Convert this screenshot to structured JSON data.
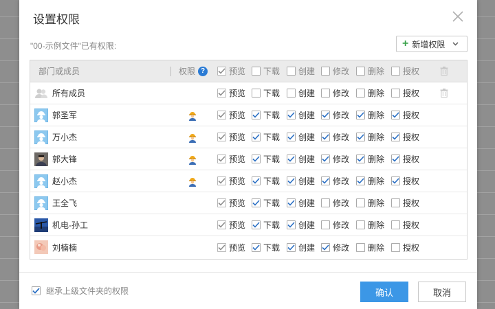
{
  "dialog": {
    "title": "设置权限",
    "subtitle": "\"00-示例文件\"已有权限:",
    "add_button_label": "新增权限"
  },
  "table": {
    "header": {
      "member_col": "部门或成员",
      "perm_col": "权限",
      "permissions": [
        "预览",
        "下载",
        "创建",
        "修改",
        "删除",
        "授权"
      ]
    },
    "rows": [
      {
        "name": "所有成员",
        "avatar": "group-avatar",
        "role_icon": false,
        "perms": [
          true,
          false,
          false,
          false,
          false,
          false
        ],
        "deletable": true
      },
      {
        "name": "郭圣军",
        "avatar": "worker-avatar",
        "role_icon": true,
        "perms": [
          true,
          true,
          true,
          true,
          true,
          true
        ],
        "deletable": false
      },
      {
        "name": "万小杰",
        "avatar": "worker-avatar",
        "role_icon": true,
        "perms": [
          true,
          true,
          true,
          true,
          true,
          true
        ],
        "deletable": false
      },
      {
        "name": "郭大锋",
        "avatar": "photo-avatar",
        "role_icon": true,
        "perms": [
          true,
          true,
          true,
          true,
          true,
          true
        ],
        "deletable": false
      },
      {
        "name": "赵小杰",
        "avatar": "worker-avatar",
        "role_icon": true,
        "perms": [
          true,
          true,
          true,
          true,
          true,
          true
        ],
        "deletable": false
      },
      {
        "name": "王全飞",
        "avatar": "worker-avatar",
        "role_icon": false,
        "perms": [
          true,
          true,
          true,
          false,
          false,
          false
        ],
        "deletable": false
      },
      {
        "name": "机电-孙工",
        "avatar": "photo-avatar-2",
        "role_icon": false,
        "perms": [
          true,
          true,
          true,
          false,
          false,
          false
        ],
        "deletable": false
      },
      {
        "name": "刘楠楠",
        "avatar": "photo-avatar-3",
        "role_icon": false,
        "perms": [
          true,
          true,
          true,
          true,
          false,
          false
        ],
        "deletable": false
      }
    ]
  },
  "footer": {
    "inherit_label": "继承上级文件夹的权限",
    "inherit_checked": true,
    "ok_label": "确认",
    "cancel_label": "取消"
  },
  "colors": {
    "primary": "#3c97e6",
    "check_blue": "#2a6fc4",
    "check_grey": "#8c8c8c",
    "help": "#2a7bd5",
    "plus_green": "#3aa24a"
  }
}
